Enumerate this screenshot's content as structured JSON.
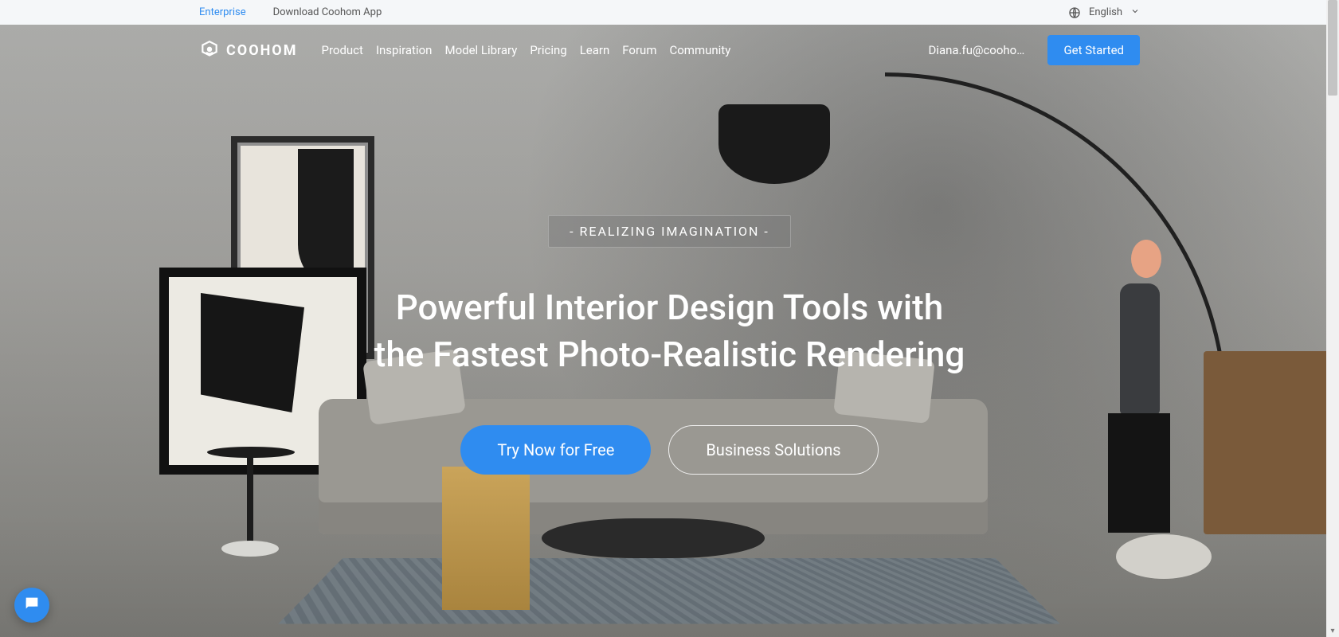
{
  "topbar": {
    "enterprise": "Enterprise",
    "download": "Download Coohom App",
    "language": "English"
  },
  "brand": {
    "name": "COOHOM"
  },
  "nav": {
    "items": [
      "Product",
      "Inspiration",
      "Model Library",
      "Pricing",
      "Learn",
      "Forum",
      "Community"
    ],
    "user_email": "Diana.fu@coohom...",
    "get_started": "Get Started"
  },
  "hero": {
    "tagline": "-  REALIZING IMAGINATION  -",
    "headline": "Powerful Interior Design Tools with the Fastest Photo-Realistic Rendering",
    "cta_primary": "Try Now for Free",
    "cta_secondary": "Business Solutions"
  }
}
